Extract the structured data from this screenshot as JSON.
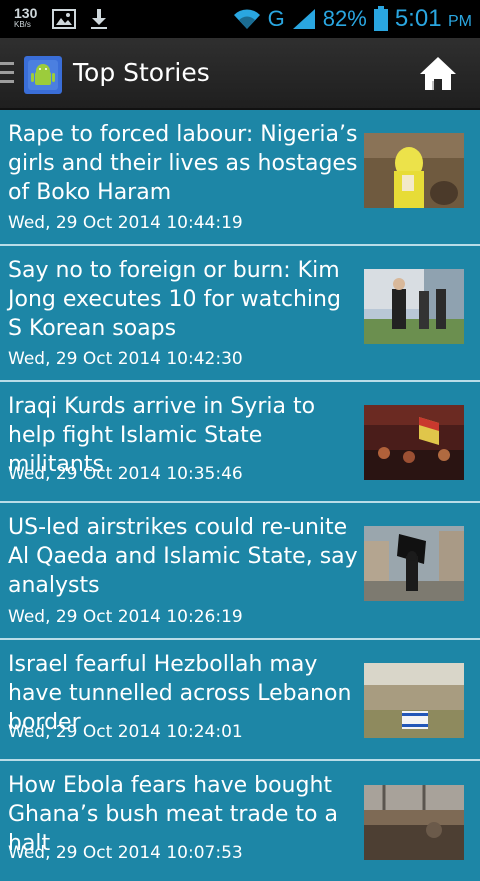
{
  "status_bar": {
    "speed_value": "130",
    "speed_unit": "KB/s",
    "network": "G",
    "battery": "82%",
    "time": "5:01",
    "ampm": "PM"
  },
  "action_bar": {
    "title": "Top Stories"
  },
  "stories": [
    {
      "headline": "Rape to forced labour: Nigeria’s girls and their lives as hostages of Boko Haram",
      "date": "Wed, 29 Oct 2014 10:44:19"
    },
    {
      "headline": "Say no to foreign or burn: Kim Jong executes 10 for watching S Korean soaps",
      "date": "Wed, 29 Oct 2014 10:42:30"
    },
    {
      "headline": "Iraqi Kurds arrive in Syria to help fight Islamic State militants",
      "date": "Wed, 29 Oct 2014 10:35:46"
    },
    {
      "headline": "US-led airstrikes could re-unite Al Qaeda and Islamic State, say analysts",
      "date": "Wed, 29 Oct 2014 10:26:19"
    },
    {
      "headline": "Israel fearful Hezbollah may have tunnelled across Lebanon border",
      "date": "Wed, 29 Oct 2014 10:24:01"
    },
    {
      "headline": "How Ebola fears have bought Ghana’s bush meat trade to a halt",
      "date": "Wed, 29 Oct 2014 10:07:53"
    }
  ]
}
